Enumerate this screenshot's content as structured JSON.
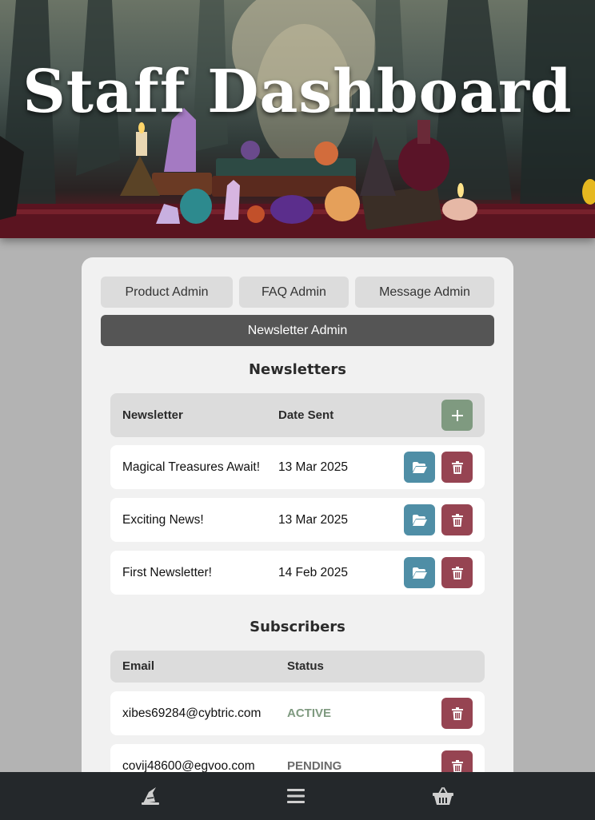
{
  "hero": {
    "title": "Staff Dashboard"
  },
  "tabs": [
    {
      "label": "Product Admin",
      "active": false
    },
    {
      "label": "FAQ Admin",
      "active": false
    },
    {
      "label": "Message Admin",
      "active": false
    },
    {
      "label": "Newsletter Admin",
      "active": true
    }
  ],
  "newsletters": {
    "title": "Newsletters",
    "columns": {
      "name": "Newsletter",
      "date": "Date Sent"
    },
    "add_icon": "plus-icon",
    "rows": [
      {
        "name": "Magical Treasures Await!",
        "date": "13 Mar 2025"
      },
      {
        "name": "Exciting News!",
        "date": "13 Mar 2025"
      },
      {
        "name": "First Newsletter!",
        "date": "14 Feb 2025"
      }
    ]
  },
  "subscribers": {
    "title": "Subscribers",
    "columns": {
      "email": "Email",
      "status": "Status"
    },
    "rows": [
      {
        "email": "xibes69284@cybtric.com",
        "status": "ACTIVE",
        "status_color": "#7f9a80"
      },
      {
        "email": "covij48600@egvoo.com",
        "status": "PENDING",
        "status_color": "#6b6b6b"
      }
    ]
  },
  "icons": {
    "open": "folder-open-icon",
    "delete": "trash-icon",
    "nav": [
      "wizard-hat-icon",
      "menu-icon",
      "basket-icon"
    ]
  },
  "colors": {
    "add_button": "#7f9a80",
    "open_button": "#4f8ea6",
    "delete_button": "#964452",
    "active_tab": "#555555",
    "bottom_nav": "#24282b"
  }
}
